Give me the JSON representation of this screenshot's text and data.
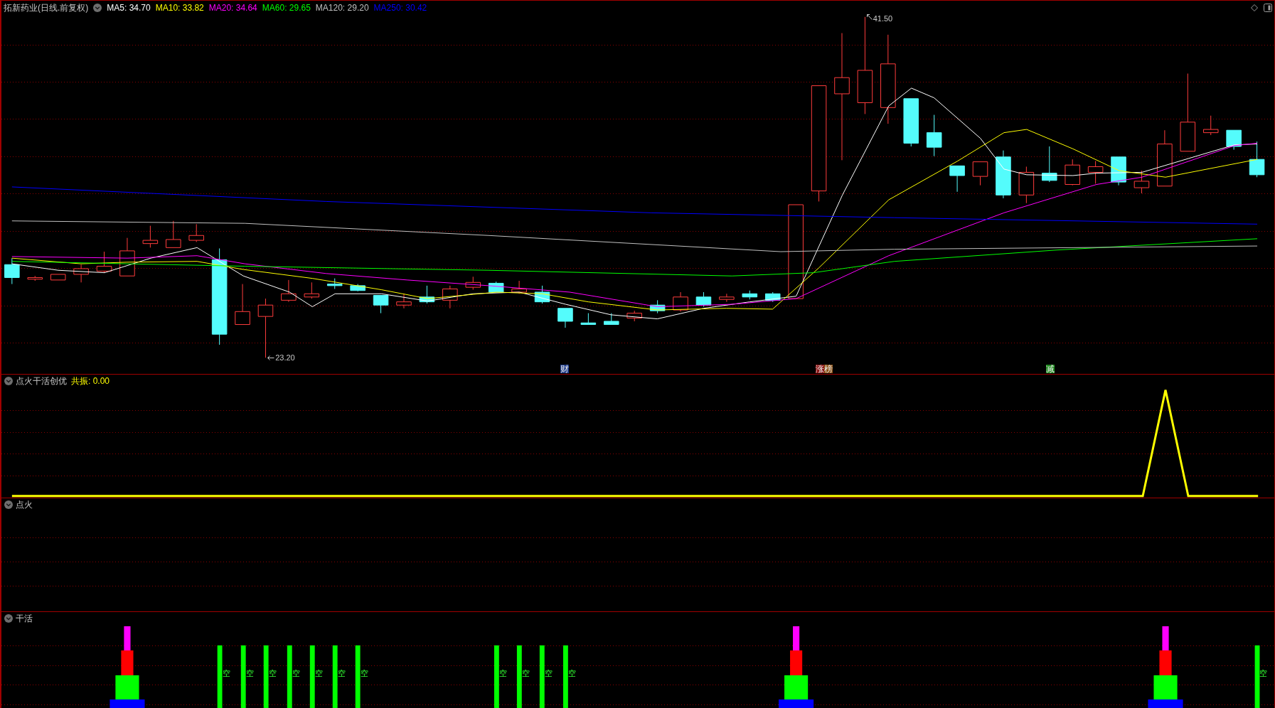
{
  "header": {
    "title": "拓新药业(日线.前复权)",
    "indicators": [
      {
        "label": "MA5: 34.70",
        "color": "#ffffff"
      },
      {
        "label": "MA10: 33.82",
        "color": "#ffff00"
      },
      {
        "label": "MA20: 34.64",
        "color": "#ff00ff"
      },
      {
        "label": "MA60: 29.65",
        "color": "#00ff00"
      },
      {
        "label": "MA120: 29.20",
        "color": "#c0c0c0"
      },
      {
        "label": "MA250: 30.42",
        "color": "#0000ff"
      }
    ]
  },
  "price_chart": {
    "high_label": "41.50",
    "low_label": "23.20",
    "events": [
      {
        "label": "财",
        "color": "#1e3c8c"
      },
      {
        "label": "涨",
        "color": "#8c1414"
      },
      {
        "label": "榜",
        "color": "#8c5014"
      },
      {
        "label": "减",
        "color": "#1e8c1e"
      }
    ]
  },
  "indicator_panels": [
    {
      "kind": "line",
      "title": "点火干活创优",
      "reading": "共振: 0.00"
    },
    {
      "kind": "blank",
      "title": "点火"
    },
    {
      "kind": "bars",
      "title": "干活",
      "signals": [
        {
          "label": "空"
        },
        {
          "label": "空"
        },
        {
          "label": "空"
        },
        {
          "label": "空"
        },
        {
          "label": "空"
        },
        {
          "label": "空"
        },
        {
          "label": "空"
        },
        {
          "label": "空"
        },
        {
          "label": "空"
        },
        {
          "label": "空"
        },
        {
          "label": "空"
        },
        {
          "label": "空"
        }
      ]
    }
  ]
}
